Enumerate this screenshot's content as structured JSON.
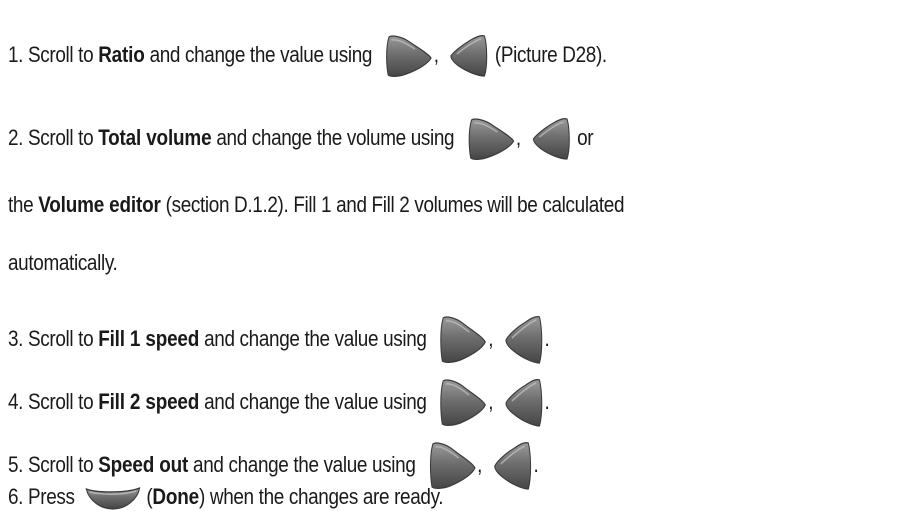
{
  "steps": [
    {
      "num": "1.",
      "pre": "Scroll to",
      "bold": "Ratio",
      "post": "and change the value using",
      "sep": ",",
      "tail": "(Picture D28)."
    },
    {
      "num": "2.",
      "pre": "Scroll to",
      "bold": "Total volume",
      "post": "and change the volume using",
      "sep": ",",
      "tail": "or"
    },
    {
      "pre_bold_prefix": "the",
      "bold": "Volume editor",
      "post": "(section D.1.2). Fill 1 and Fill 2 volumes will be calculated"
    },
    {
      "text": "automatically."
    },
    {
      "num": "3.",
      "pre": "Scroll to",
      "bold": "Fill 1 speed",
      "post": "and change the value using",
      "sep": ",",
      "tail": "."
    },
    {
      "num": "4.",
      "pre": "Scroll to",
      "bold": "Fill 2 speed",
      "post": "and change the value using",
      "sep": ",",
      "tail": "."
    },
    {
      "num": "5.",
      "pre": "Scroll to",
      "bold": "Speed out",
      "post": "and change the value using",
      "sep": ",",
      "tail": "."
    },
    {
      "num": "6.",
      "pre": "Press",
      "open_paren": "(",
      "bold": "Done",
      "post": ") when the changes are ready."
    }
  ],
  "icons": {
    "right": "right-arrow-button-icon",
    "left": "left-arrow-button-icon",
    "done": "done-button-icon"
  },
  "colors": {
    "button_fill": "#6f6f6f",
    "button_edge": "#3c3c3c",
    "button_highlight": "#a8a8a8",
    "text": "#1a1a1a"
  }
}
